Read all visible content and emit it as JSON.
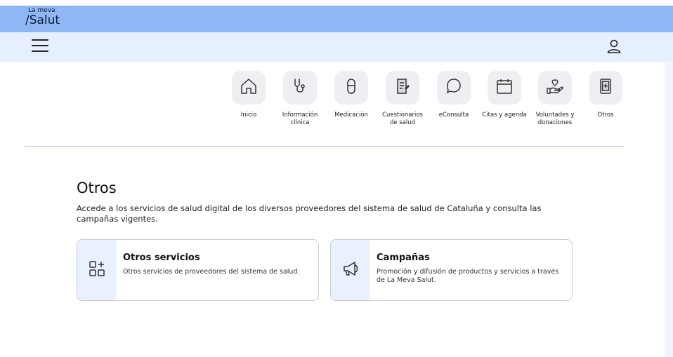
{
  "brand": {
    "logo_top": "La meva",
    "logo_main": "/Salut"
  },
  "nav": {
    "menu_icon": "hamburger-menu-icon",
    "user_icon": "user-icon"
  },
  "tiles": [
    {
      "label": "Inicio",
      "icon": "home-icon"
    },
    {
      "label": "Información clínica",
      "icon": "stethoscope-icon"
    },
    {
      "label": "Medicación",
      "icon": "pill-icon"
    },
    {
      "label": "Cuestionarios de salud",
      "icon": "questionnaire-icon"
    },
    {
      "label": "eConsulta",
      "icon": "chat-bubble-icon"
    },
    {
      "label": "Citas y agenda",
      "icon": "calendar-icon"
    },
    {
      "label": "Voluntades y donaciones",
      "icon": "heart-hand-icon"
    },
    {
      "label": "Otros",
      "icon": "tablet-icon"
    }
  ],
  "main": {
    "title": "Otros",
    "description": "Accede a los servicios de salud digital de los diversos proveedores del sistema de salud de Cataluña y consulta las campañas vigentes."
  },
  "cards": [
    {
      "title": "Otros servicios",
      "description": "Otros servicios de proveedores del sistema de salud.",
      "icon": "apps-grid-plus-icon"
    },
    {
      "title": "Campañas",
      "description": "Promoción y difusión de productos y servicios a través de La Meva Salut.",
      "icon": "megaphone-icon"
    }
  ]
}
